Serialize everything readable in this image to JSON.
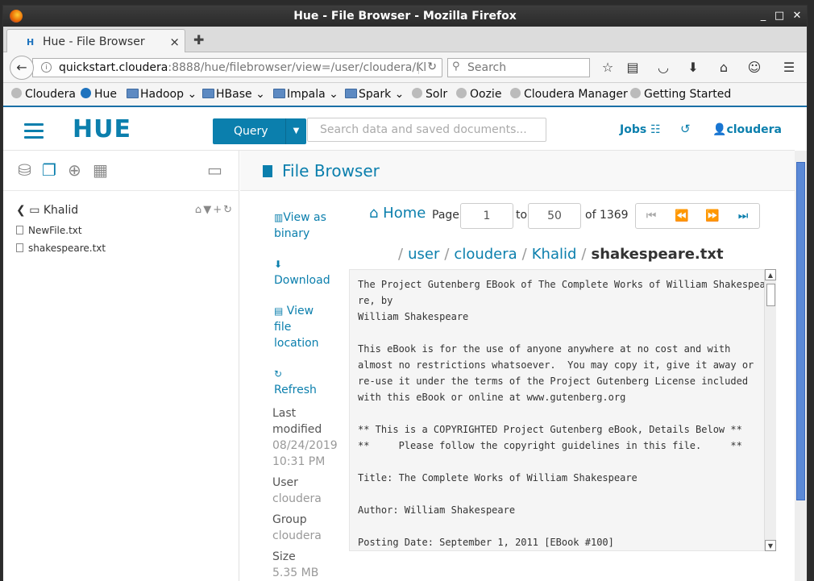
{
  "window": {
    "title": "Hue - File Browser - Mozilla Firefox"
  },
  "tab": {
    "label": "Hue - File Browser",
    "close": "×"
  },
  "nav": {
    "url_host": "quickstart.cloudera",
    "url_rest": ":8888/hue/filebrowser/view=/user/cloudera/Kl",
    "search_placeholder": "Search"
  },
  "bookmarks": [
    {
      "label": "Cloudera",
      "kind": "globe"
    },
    {
      "label": "Hue",
      "kind": "hue"
    },
    {
      "label": "Hadoop",
      "kind": "folder"
    },
    {
      "label": "HBase",
      "kind": "folder"
    },
    {
      "label": "Impala",
      "kind": "folder"
    },
    {
      "label": "Spark",
      "kind": "folder"
    },
    {
      "label": "Solr",
      "kind": "globe"
    },
    {
      "label": "Oozie",
      "kind": "globe"
    },
    {
      "label": "Cloudera Manager",
      "kind": "globe"
    },
    {
      "label": "Getting Started",
      "kind": "globe"
    }
  ],
  "hue": {
    "logo": "HUE",
    "query_label": "Query",
    "search_placeholder": "Search data and saved documents...",
    "jobs_label": "Jobs",
    "user_label": "cloudera"
  },
  "left": {
    "folder": "Khalid",
    "files": [
      "NewFile.txt",
      "shakespeare.txt"
    ]
  },
  "main": {
    "title": "File Browser",
    "actions": {
      "view_binary": "View as binary",
      "download": "Download",
      "view_location": "View file location",
      "refresh": "Refresh"
    },
    "meta": {
      "last_modified_label": "Last modified",
      "last_modified_value": "08/24/2019 10:31 PM",
      "user_label": "User",
      "user_value": "cloudera",
      "group_label": "Group",
      "group_value": "cloudera",
      "size_label": "Size",
      "size_value": "5.35 MB"
    },
    "pager": {
      "home": "Home",
      "page_label": "Page",
      "from": "1",
      "to_label": "to",
      "to": "50",
      "of_label": "of 1369"
    },
    "path": [
      "user",
      "cloudera",
      "Khalid"
    ],
    "path_current": "shakespeare.txt",
    "content": "The Project Gutenberg EBook of The Complete Works of William Shakespea\nre, by\nWilliam Shakespeare\n\nThis eBook is for the use of anyone anywhere at no cost and with\nalmost no restrictions whatsoever.  You may copy it, give it away or\nre-use it under the terms of the Project Gutenberg License included\nwith this eBook or online at www.gutenberg.org\n\n** This is a COPYRIGHTED Project Gutenberg eBook, Details Below **\n**     Please follow the copyright guidelines in this file.     **\n\nTitle: The Complete Works of William Shakespeare\n\nAuthor: William Shakespeare\n\nPosting Date: September 1, 2011 [EBook #100]"
  }
}
